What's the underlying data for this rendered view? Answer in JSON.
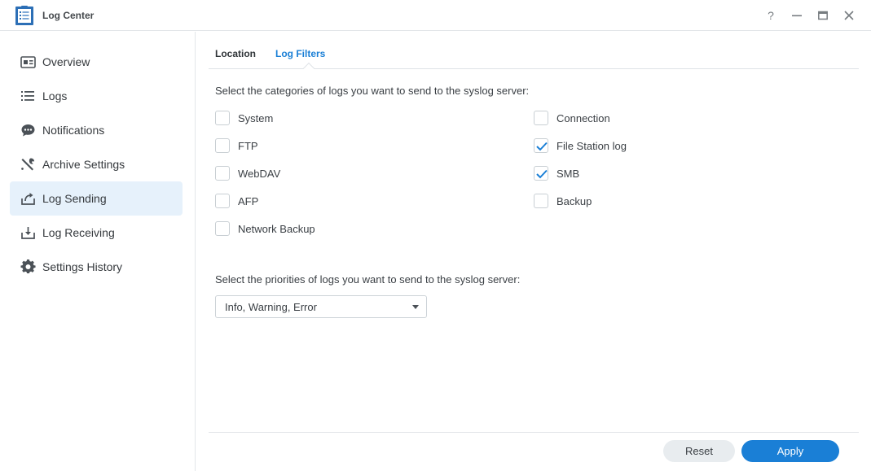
{
  "window": {
    "title": "Log Center",
    "help_glyph": "?",
    "accent_color": "#1a7fd6"
  },
  "sidebar": {
    "items": [
      {
        "label": "Overview",
        "icon": "overview-card-icon",
        "active": false
      },
      {
        "label": "Logs",
        "icon": "list-icon",
        "active": false
      },
      {
        "label": "Notifications",
        "icon": "chat-bubble-icon",
        "active": false
      },
      {
        "label": "Archive Settings",
        "icon": "tools-icon",
        "active": false
      },
      {
        "label": "Log Sending",
        "icon": "upload-tray-icon",
        "active": true
      },
      {
        "label": "Log Receiving",
        "icon": "download-tray-icon",
        "active": false
      },
      {
        "label": "Settings History",
        "icon": "gear-icon",
        "active": false
      }
    ]
  },
  "tabs": {
    "location": "Location",
    "log_filters": "Log Filters"
  },
  "filters": {
    "categories_desc": "Select the categories of logs you want to send to the syslog server:",
    "categories": [
      {
        "label": "System",
        "checked": false
      },
      {
        "label": "FTP",
        "checked": false
      },
      {
        "label": "WebDAV",
        "checked": false
      },
      {
        "label": "AFP",
        "checked": false
      },
      {
        "label": "Network Backup",
        "checked": false
      },
      {
        "label": "Connection",
        "checked": false
      },
      {
        "label": "File Station log",
        "checked": true
      },
      {
        "label": "SMB",
        "checked": true
      },
      {
        "label": "Backup",
        "checked": false
      }
    ],
    "priorities_desc": "Select the priorities of logs you want to send to the syslog server:",
    "priority_value": "Info, Warning, Error"
  },
  "footer": {
    "reset_label": "Reset",
    "apply_label": "Apply"
  }
}
